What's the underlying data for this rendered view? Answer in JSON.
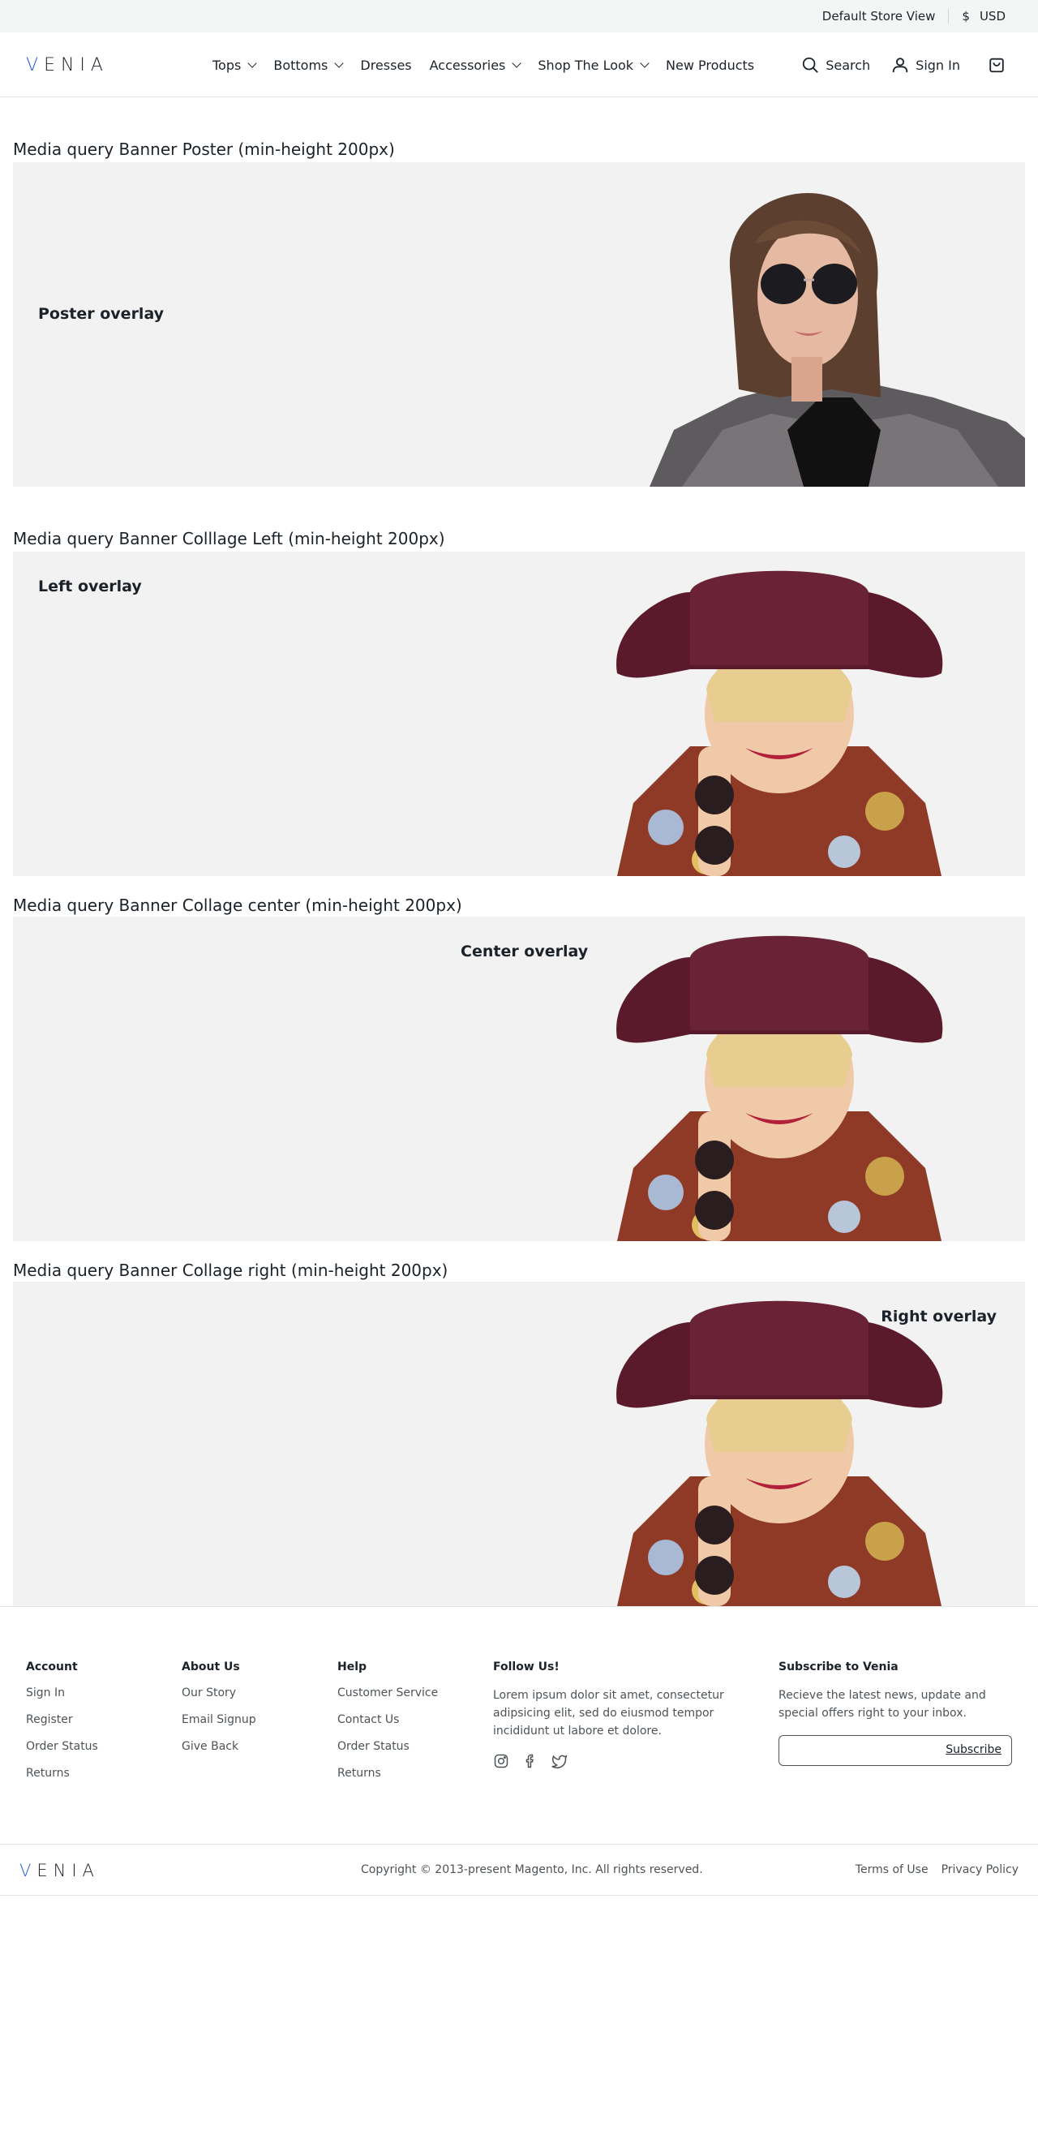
{
  "topbar": {
    "store": "Default Store View",
    "currency_symbol": "$",
    "currency": "USD"
  },
  "header": {
    "logo": "VENIA",
    "nav": [
      {
        "label": "Tops",
        "dropdown": true
      },
      {
        "label": "Bottoms",
        "dropdown": true
      },
      {
        "label": "Dresses",
        "dropdown": false
      },
      {
        "label": "Accessories",
        "dropdown": true
      },
      {
        "label": "Shop The Look",
        "dropdown": true
      },
      {
        "label": "New Products",
        "dropdown": false
      }
    ],
    "search_label": "Search",
    "signin_label": "Sign In"
  },
  "banners": [
    {
      "title": "Media query Banner Poster (min-height 200px)",
      "overlay": "Poster overlay"
    },
    {
      "title": "Media query Banner Colllage Left  (min-height 200px)",
      "overlay": "Left overlay"
    },
    {
      "title": "Media query Banner Collage center (min-height 200px)",
      "overlay": "Center overlay"
    },
    {
      "title": "Media query Banner Collage right (min-height 200px)",
      "overlay": "Right overlay"
    }
  ],
  "footer": {
    "account": {
      "heading": "Account",
      "links": [
        "Sign In",
        "Register",
        "Order Status",
        "Returns"
      ]
    },
    "about": {
      "heading": "About Us",
      "links": [
        "Our Story",
        "Email Signup",
        "Give Back"
      ]
    },
    "help": {
      "heading": "Help",
      "links": [
        "Customer Service",
        "Contact Us",
        "Order Status",
        "Returns"
      ]
    },
    "follow": {
      "heading": "Follow Us!",
      "text": "Lorem ipsum dolor sit amet, consectetur adipsicing elit, sed do eiusmod tempor incididunt ut labore et dolore."
    },
    "subscribe": {
      "heading": "Subscribe to Venia",
      "text": "Recieve the latest news, update and special offers right to your inbox.",
      "button": "Subscribe",
      "placeholder": ""
    },
    "logo": "VENIA",
    "copyright": "Copyright © 2013-present Magento, Inc. All rights reserved.",
    "terms": "Terms of Use",
    "privacy": "Privacy Policy"
  },
  "colors": {
    "accent": "#2b5bd9",
    "banner_bg": "#f2f2f2",
    "topbar_bg": "#f4f5f5"
  }
}
